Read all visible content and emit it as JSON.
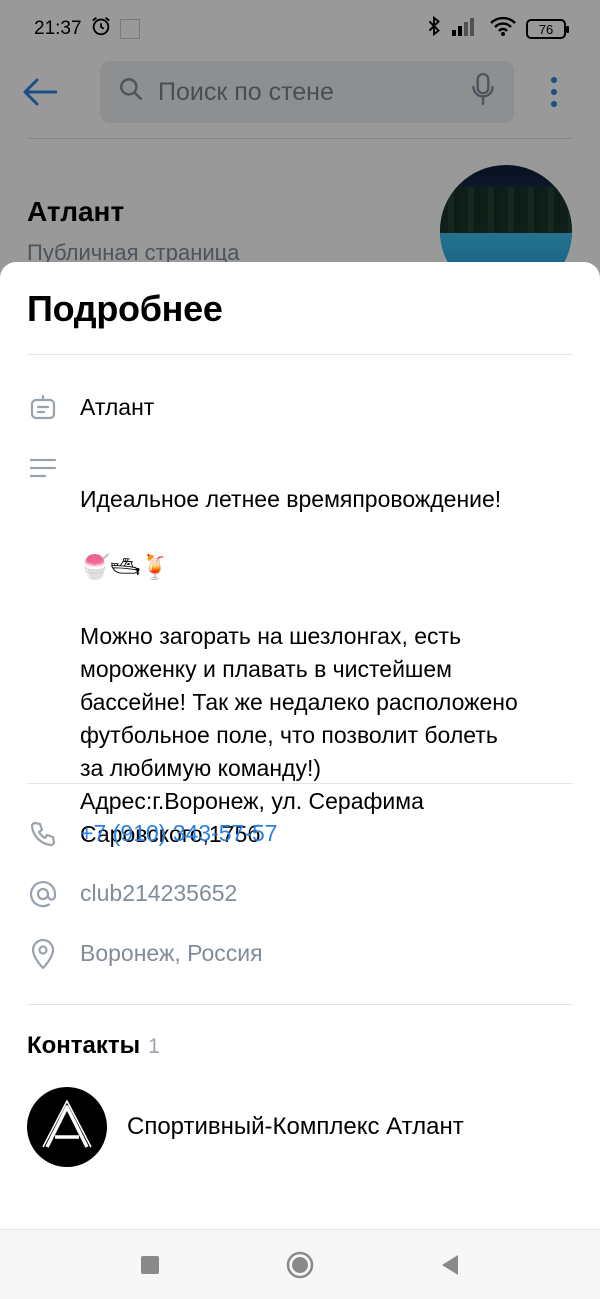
{
  "status_bar": {
    "time": "21:37",
    "battery": "76"
  },
  "header": {
    "search_placeholder": "Поиск по стене"
  },
  "community": {
    "name": "Атлант",
    "type": "Публичная страница"
  },
  "sheet": {
    "title": "Подробнее",
    "name_row": {
      "icon": "bot-icon",
      "text": "Атлант"
    },
    "description": {
      "icon": "text-lines-icon",
      "line1": "Идеальное летнее времяпровождение!",
      "emoji": "🍧🛥🍹",
      "rest": "Можно загорать на шезлонгах, есть\nмороженку и плавать в чистейшем\nбассейне! Так же недалеко расположено\nфутбольное поле, что позволит  болеть\nза любимую команду!)\nАдрес:г.Воронеж, ул. Серафима\nСаровского,175б"
    },
    "phone": {
      "icon": "phone-icon",
      "text": "+7 (910) 343-57-57"
    },
    "address_short": {
      "icon": "at-icon",
      "text": "club214235652"
    },
    "location": {
      "icon": "pin-icon",
      "text": "Воронеж, Россия"
    },
    "contacts": {
      "title": "Контакты",
      "count": "1",
      "items": [
        {
          "name": "Спортивный-Комплекс Атлант"
        }
      ]
    }
  },
  "colors": {
    "accent": "#2d81e0",
    "muted": "#818c99",
    "icon": "#99a2ad"
  }
}
